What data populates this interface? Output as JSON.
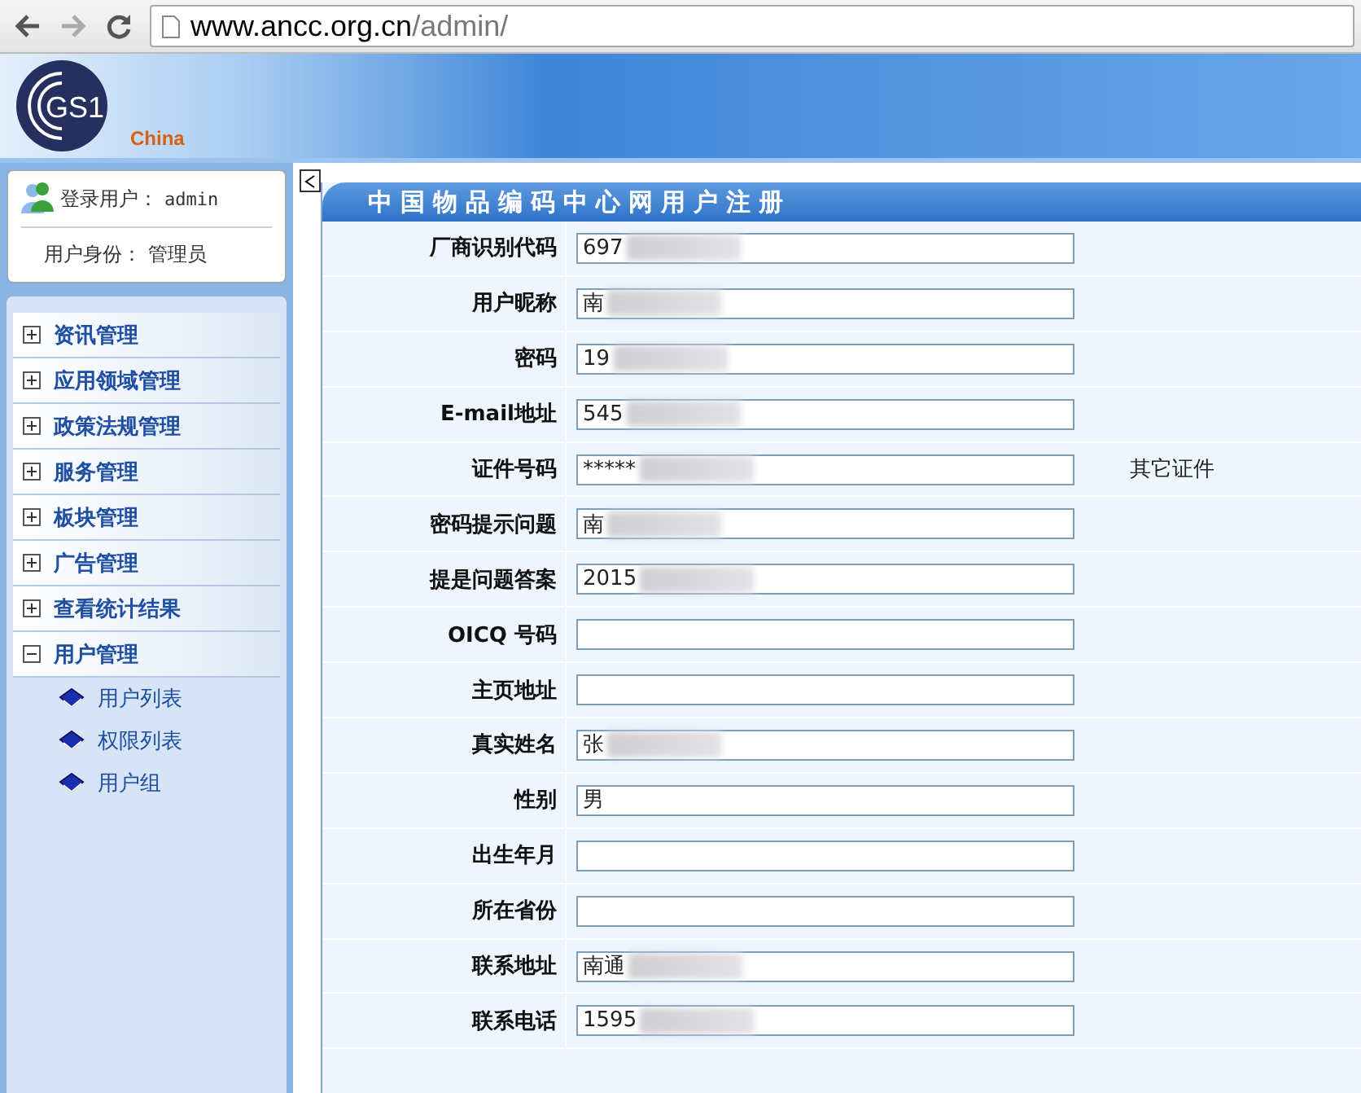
{
  "browser": {
    "url_host": "www.ancc.org.cn",
    "url_path": "/admin/"
  },
  "header": {
    "logo_text": "GS1",
    "logo_sub": "China"
  },
  "user_box": {
    "login_label": "登录用户：",
    "login_value": "admin",
    "role_label": "用户身份：",
    "role_value": "管理员"
  },
  "sidebar": {
    "items": [
      {
        "label": "资讯管理",
        "expanded": false
      },
      {
        "label": "应用领域管理",
        "expanded": false
      },
      {
        "label": "政策法规管理",
        "expanded": false
      },
      {
        "label": "服务管理",
        "expanded": false
      },
      {
        "label": "板块管理",
        "expanded": false
      },
      {
        "label": "广告管理",
        "expanded": false
      },
      {
        "label": "查看统计结果",
        "expanded": false
      },
      {
        "label": "用户管理",
        "expanded": true,
        "children": [
          {
            "label": "用户列表"
          },
          {
            "label": "权限列表"
          },
          {
            "label": "用户组"
          }
        ]
      }
    ]
  },
  "form": {
    "title": "中国物品编码中心网用户注册",
    "rows": [
      {
        "label": "厂商识别代码",
        "value": "697",
        "redacted": true
      },
      {
        "label": "用户昵称",
        "value": "南",
        "redacted": true
      },
      {
        "label": "密码",
        "value": "19",
        "redacted": true
      },
      {
        "label": "E-mail地址",
        "value": "545",
        "redacted": true
      },
      {
        "label": "证件号码",
        "value": "*****",
        "redacted": true,
        "note": "其它证件"
      },
      {
        "label": "密码提示问题",
        "value": "南",
        "redacted": true
      },
      {
        "label": "提是问题答案",
        "value": "2015",
        "redacted": true
      },
      {
        "label": "OICQ 号码",
        "redacted": false
      },
      {
        "label": "主页地址",
        "redacted": false
      },
      {
        "label": "真实姓名",
        "value": "张",
        "redacted": true
      },
      {
        "label": "性别",
        "value": "男",
        "redacted": false
      },
      {
        "label": "出生年月",
        "redacted": false
      },
      {
        "label": "所在省份",
        "redacted": false
      },
      {
        "label": "联系地址",
        "value": "南通",
        "redacted": true
      },
      {
        "label": "联系电话",
        "value": "1595",
        "redacted": true
      }
    ]
  }
}
